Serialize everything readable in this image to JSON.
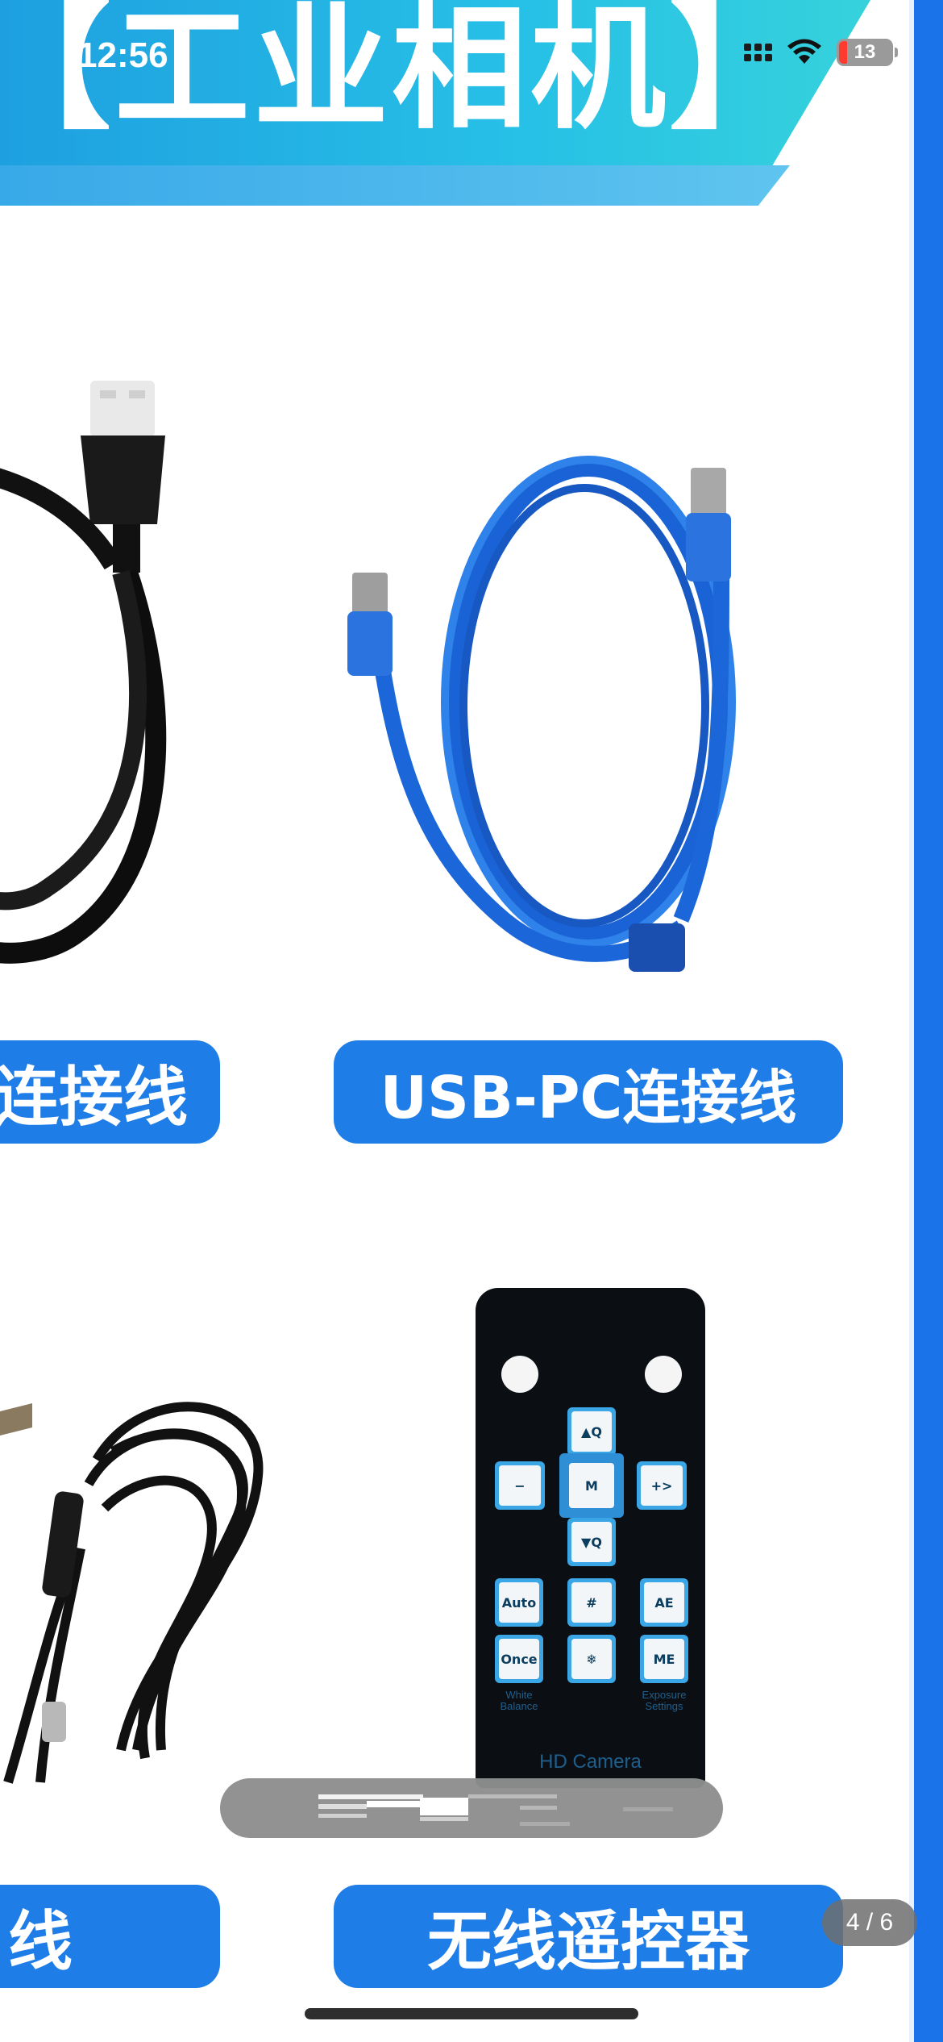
{
  "status_bar": {
    "time": "12:56",
    "battery": "13"
  },
  "banner": {
    "title": "【工业相机】"
  },
  "products": {
    "left_top_label": "连接线",
    "usb_label": "USB-PC连接线",
    "left_bottom_label": "线",
    "remote_label": "无线遥控器"
  },
  "remote": {
    "brand": "HD Camera",
    "buttons": {
      "zoom_in": "▲Q",
      "minus": "−",
      "menu": "M",
      "plus": "+>",
      "zoom_out": "▼Q",
      "auto": "Auto",
      "grid": "#",
      "ae": "AE",
      "once": "Once",
      "freeze": "❄",
      "me": "ME"
    },
    "captions": {
      "white_balance": "White Balance",
      "exposure": "Exposure Settings"
    }
  },
  "viewer": {
    "page_counter": "4 / 6"
  },
  "colors": {
    "accent": "#1f7de8",
    "cable_blue": "#1a63d6",
    "banner": "#27c0e6"
  }
}
